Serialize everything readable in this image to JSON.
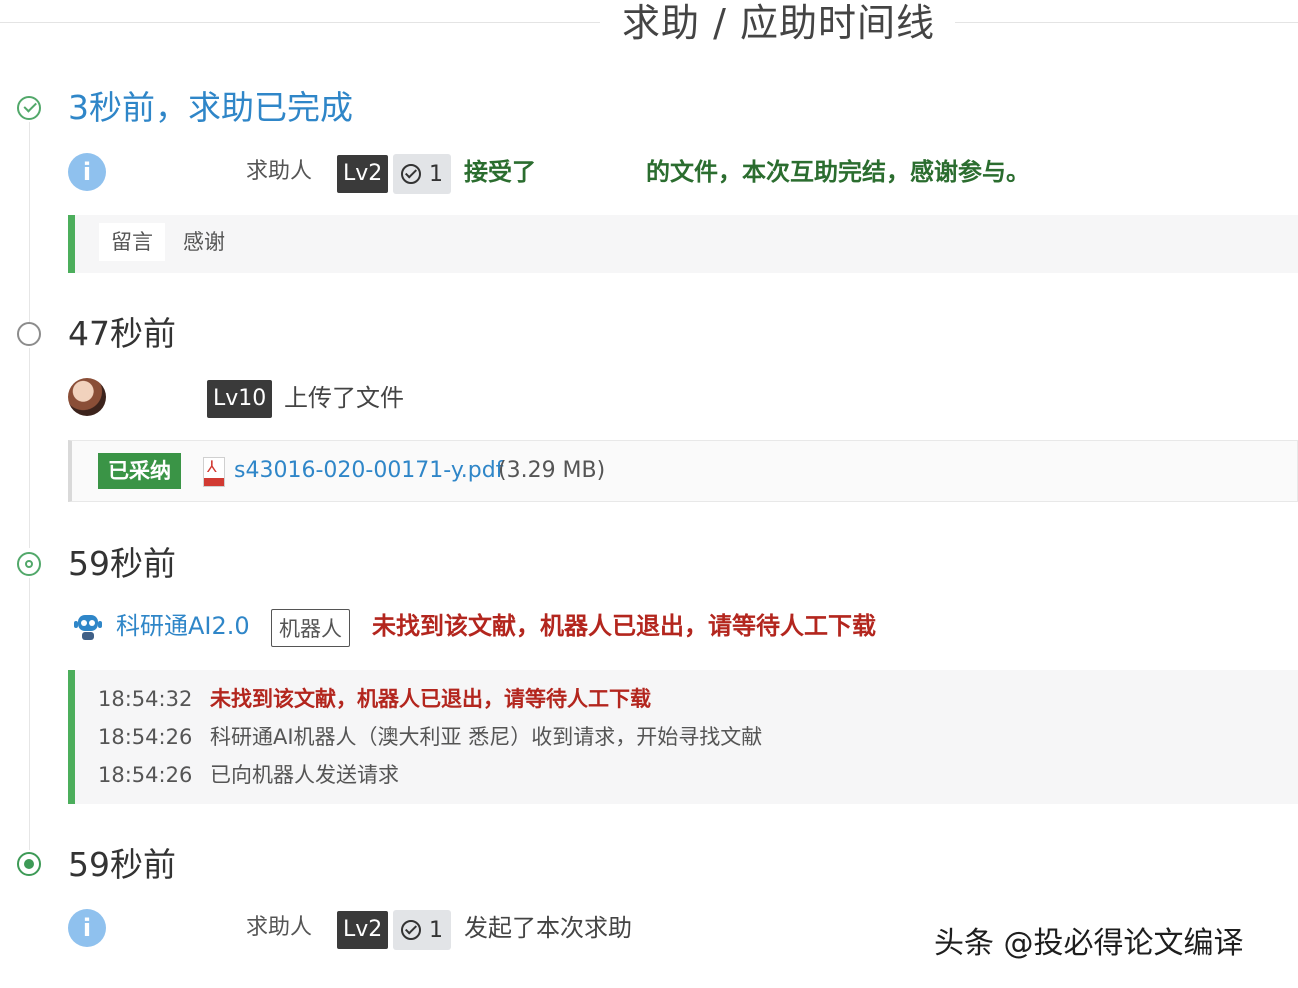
{
  "header": {
    "title": "求助 / 应助时间线"
  },
  "events": [
    {
      "time": "3秒前，求助已完成",
      "role": "求助人",
      "level": "Lv2",
      "check_count": "1",
      "action_prefix": "接受了",
      "action_suffix": "的文件，本次互助完结，感谢参与。",
      "tags": [
        "留言",
        "感谢"
      ]
    },
    {
      "time": "47秒前",
      "level": "Lv10",
      "action": "上传了文件",
      "adopted_label": "已采纳",
      "file_name": "s43016-020-00171-y.pdf",
      "file_size": "(3.29 MB)"
    },
    {
      "time": "59秒前",
      "bot_name": "科研通AI2.0",
      "bot_tag": "机器人",
      "message": "未找到该文献，机器人已退出，请等待人工下载",
      "logs": [
        {
          "time": "18:54:32",
          "text": "未找到该文献，机器人已退出，请等待人工下载"
        },
        {
          "time": "18:54:26",
          "text": "科研通AI机器人（澳大利亚 悉尼）收到请求，开始寻找文献"
        },
        {
          "time": "18:54:26",
          "text": "已向机器人发送请求"
        }
      ]
    },
    {
      "time": "59秒前",
      "role": "求助人",
      "level": "Lv2",
      "check_count": "1",
      "action": "发起了本次求助"
    }
  ],
  "watermark": "头条 @投必得论文编译",
  "colors": {
    "accent_blue": "#2f86c8",
    "accent_green": "#4cae5c",
    "alert_red": "#b3261e"
  }
}
